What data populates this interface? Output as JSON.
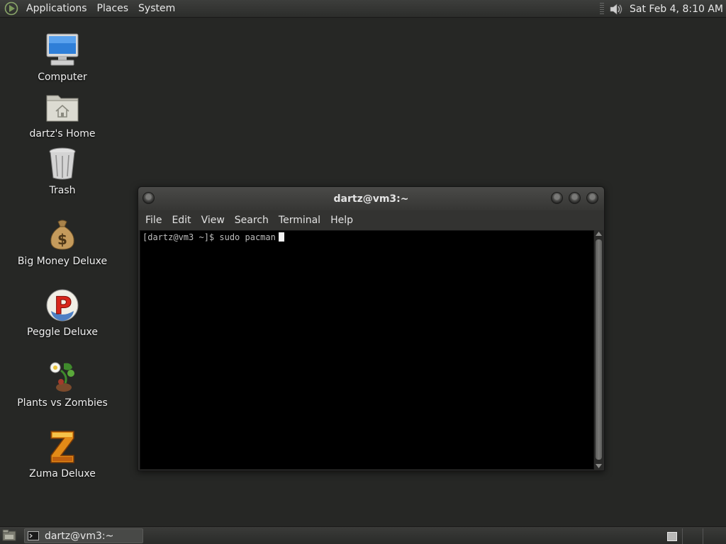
{
  "top_panel": {
    "menus": [
      "Applications",
      "Places",
      "System"
    ],
    "clock": "Sat Feb  4,  8:10 AM",
    "icons": [
      "distro-logo-icon",
      "volume-icon"
    ]
  },
  "desktop": {
    "icons": [
      {
        "label": "Computer",
        "icon": "computer-icon"
      },
      {
        "label": "dartz's Home",
        "icon": "home-folder-icon"
      },
      {
        "label": "Trash",
        "icon": "trash-icon"
      },
      {
        "label": "Big Money Deluxe",
        "icon": "money-bag-icon"
      },
      {
        "label": "Peggle Deluxe",
        "icon": "peggle-icon"
      },
      {
        "label": "Plants vs Zombies",
        "icon": "plants-vs-zombies-icon"
      },
      {
        "label": "Zuma Deluxe",
        "icon": "zuma-icon"
      }
    ]
  },
  "terminal": {
    "title": "dartz@vm3:~",
    "menu": [
      "File",
      "Edit",
      "View",
      "Search",
      "Terminal",
      "Help"
    ],
    "prompt": "[dartz@vm3 ~]$ sudo pacman"
  },
  "bottom_panel": {
    "task_label": "dartz@vm3:~"
  },
  "colors": {
    "desktop_bg": "#262725",
    "terminal_bg": "#000000",
    "terminal_text": "#bdbdbd"
  }
}
